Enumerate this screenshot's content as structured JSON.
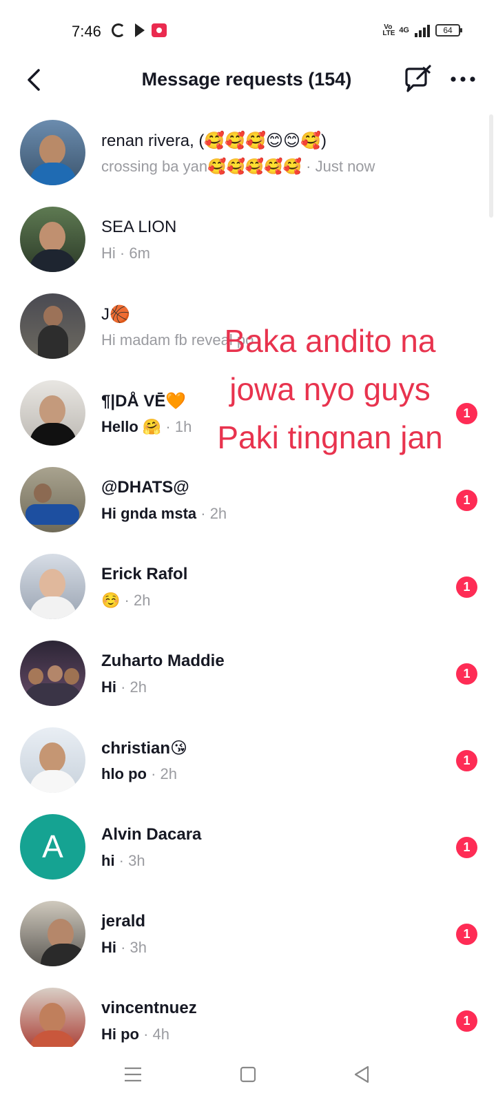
{
  "status_bar": {
    "time": "7:46",
    "network": "4G",
    "volte": "Vo LTE",
    "battery": "64"
  },
  "header": {
    "title": "Message requests (154)"
  },
  "overlay": {
    "lines": [
      "Baka andito na",
      "jowa nyo guys",
      "Paki tingnan jan"
    ],
    "color": "#e8334e"
  },
  "requests": [
    {
      "name": "renan rivera, (🥰🥰🥰😊😊🥰)",
      "message": "crossing ba yan🥰🥰🥰🥰🥰",
      "time": " · Just now",
      "unread": false,
      "badge": ""
    },
    {
      "name": "SEA LION",
      "message": "Hi",
      "time": " · 6m",
      "unread": false,
      "badge": ""
    },
    {
      "name": "J🏀",
      "message": "Hi madam fb reveal po",
      "time": "",
      "unread": false,
      "badge": ""
    },
    {
      "name": "¶|DÅ VĒ🧡",
      "message": "Hello 🤗",
      "time": " · 1h",
      "unread": true,
      "badge": "1"
    },
    {
      "name": "@DHATS@",
      "message": "Hi gnda msta",
      "time": " · 2h",
      "unread": true,
      "badge": "1"
    },
    {
      "name": "Erick Rafol",
      "message": "☺️",
      "time": " · 2h",
      "unread": true,
      "badge": "1"
    },
    {
      "name": "Zuharto Maddie",
      "message": "Hi",
      "time": " · 2h",
      "unread": true,
      "badge": "1"
    },
    {
      "name": "christian😘",
      "message": "hlo po",
      "time": " · 2h",
      "unread": true,
      "badge": "1"
    },
    {
      "name": "Alvin Dacara",
      "message": "hi",
      "time": " · 3h",
      "unread": true,
      "badge": "1",
      "avatar_letter": "A"
    },
    {
      "name": "jerald",
      "message": "Hi",
      "time": " · 3h",
      "unread": true,
      "badge": "1"
    },
    {
      "name": "vincentnuez",
      "message": "Hi po",
      "time": " · 4h",
      "unread": true,
      "badge": "1"
    }
  ],
  "colors": {
    "badge": "#fe2c55",
    "letter_avatar": "#15a392",
    "text_primary": "#161823",
    "text_secondary": "#9a9ba0"
  }
}
